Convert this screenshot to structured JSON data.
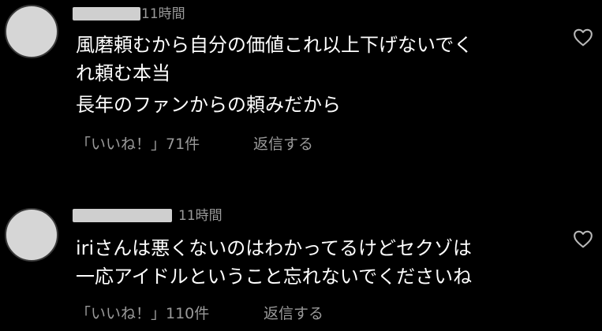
{
  "comments": [
    {
      "time": "11時間",
      "lines": [
        "風磨頼むから自分の価値これ以上下げないでく",
        "れ頼む本当",
        "長年のファンからの頼みだから"
      ],
      "likes": "「いいね！」71件",
      "reply": "返信する"
    },
    {
      "time": "11時間",
      "lines": [
        "iriさんは悪くないのはわかってるけどセクゾは",
        "一応アイドルということ忘れないでくださいね"
      ],
      "likes": "「いいね！」110件",
      "reply": "返信する"
    }
  ],
  "colors": {
    "background": "#000000",
    "text": "#ffffff",
    "muted": "#9a9a9a",
    "avatar": "#d6d6d6"
  },
  "icons": {
    "like": "heart-outline-icon"
  }
}
